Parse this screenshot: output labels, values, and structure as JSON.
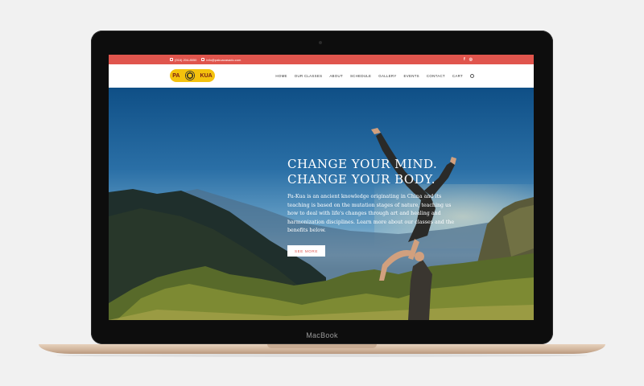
{
  "device": {
    "label": "MacBook"
  },
  "topbar": {
    "phone": "(916) 204-8550",
    "email": "info@pakuacasadu.com",
    "social": [
      "facebook-icon",
      "instagram-icon"
    ],
    "social_glyphs": [
      "f",
      "◎"
    ]
  },
  "logo": {
    "left_text": "PA",
    "right_text": "KUA"
  },
  "nav": {
    "items": [
      "HOME",
      "OUR CLASSES",
      "ABOUT",
      "SCHEDULE",
      "GALLERY",
      "EVENTS",
      "CONTACT",
      "CART"
    ]
  },
  "hero": {
    "title_line1": "CHANGE YOUR MIND.",
    "title_line2": "CHANGE YOUR BODY.",
    "text": "Pa-Kua is an ancient knowledge originating in China and its teaching is based on the mutation stages of nature, teaching us how to deal with life's changes through art and healing and harmonization disciplines. Learn more about our classes and the benefits below.",
    "button": "SEE MORE"
  },
  "colors": {
    "accent": "#e0554d",
    "logo": "#f4c20d"
  }
}
